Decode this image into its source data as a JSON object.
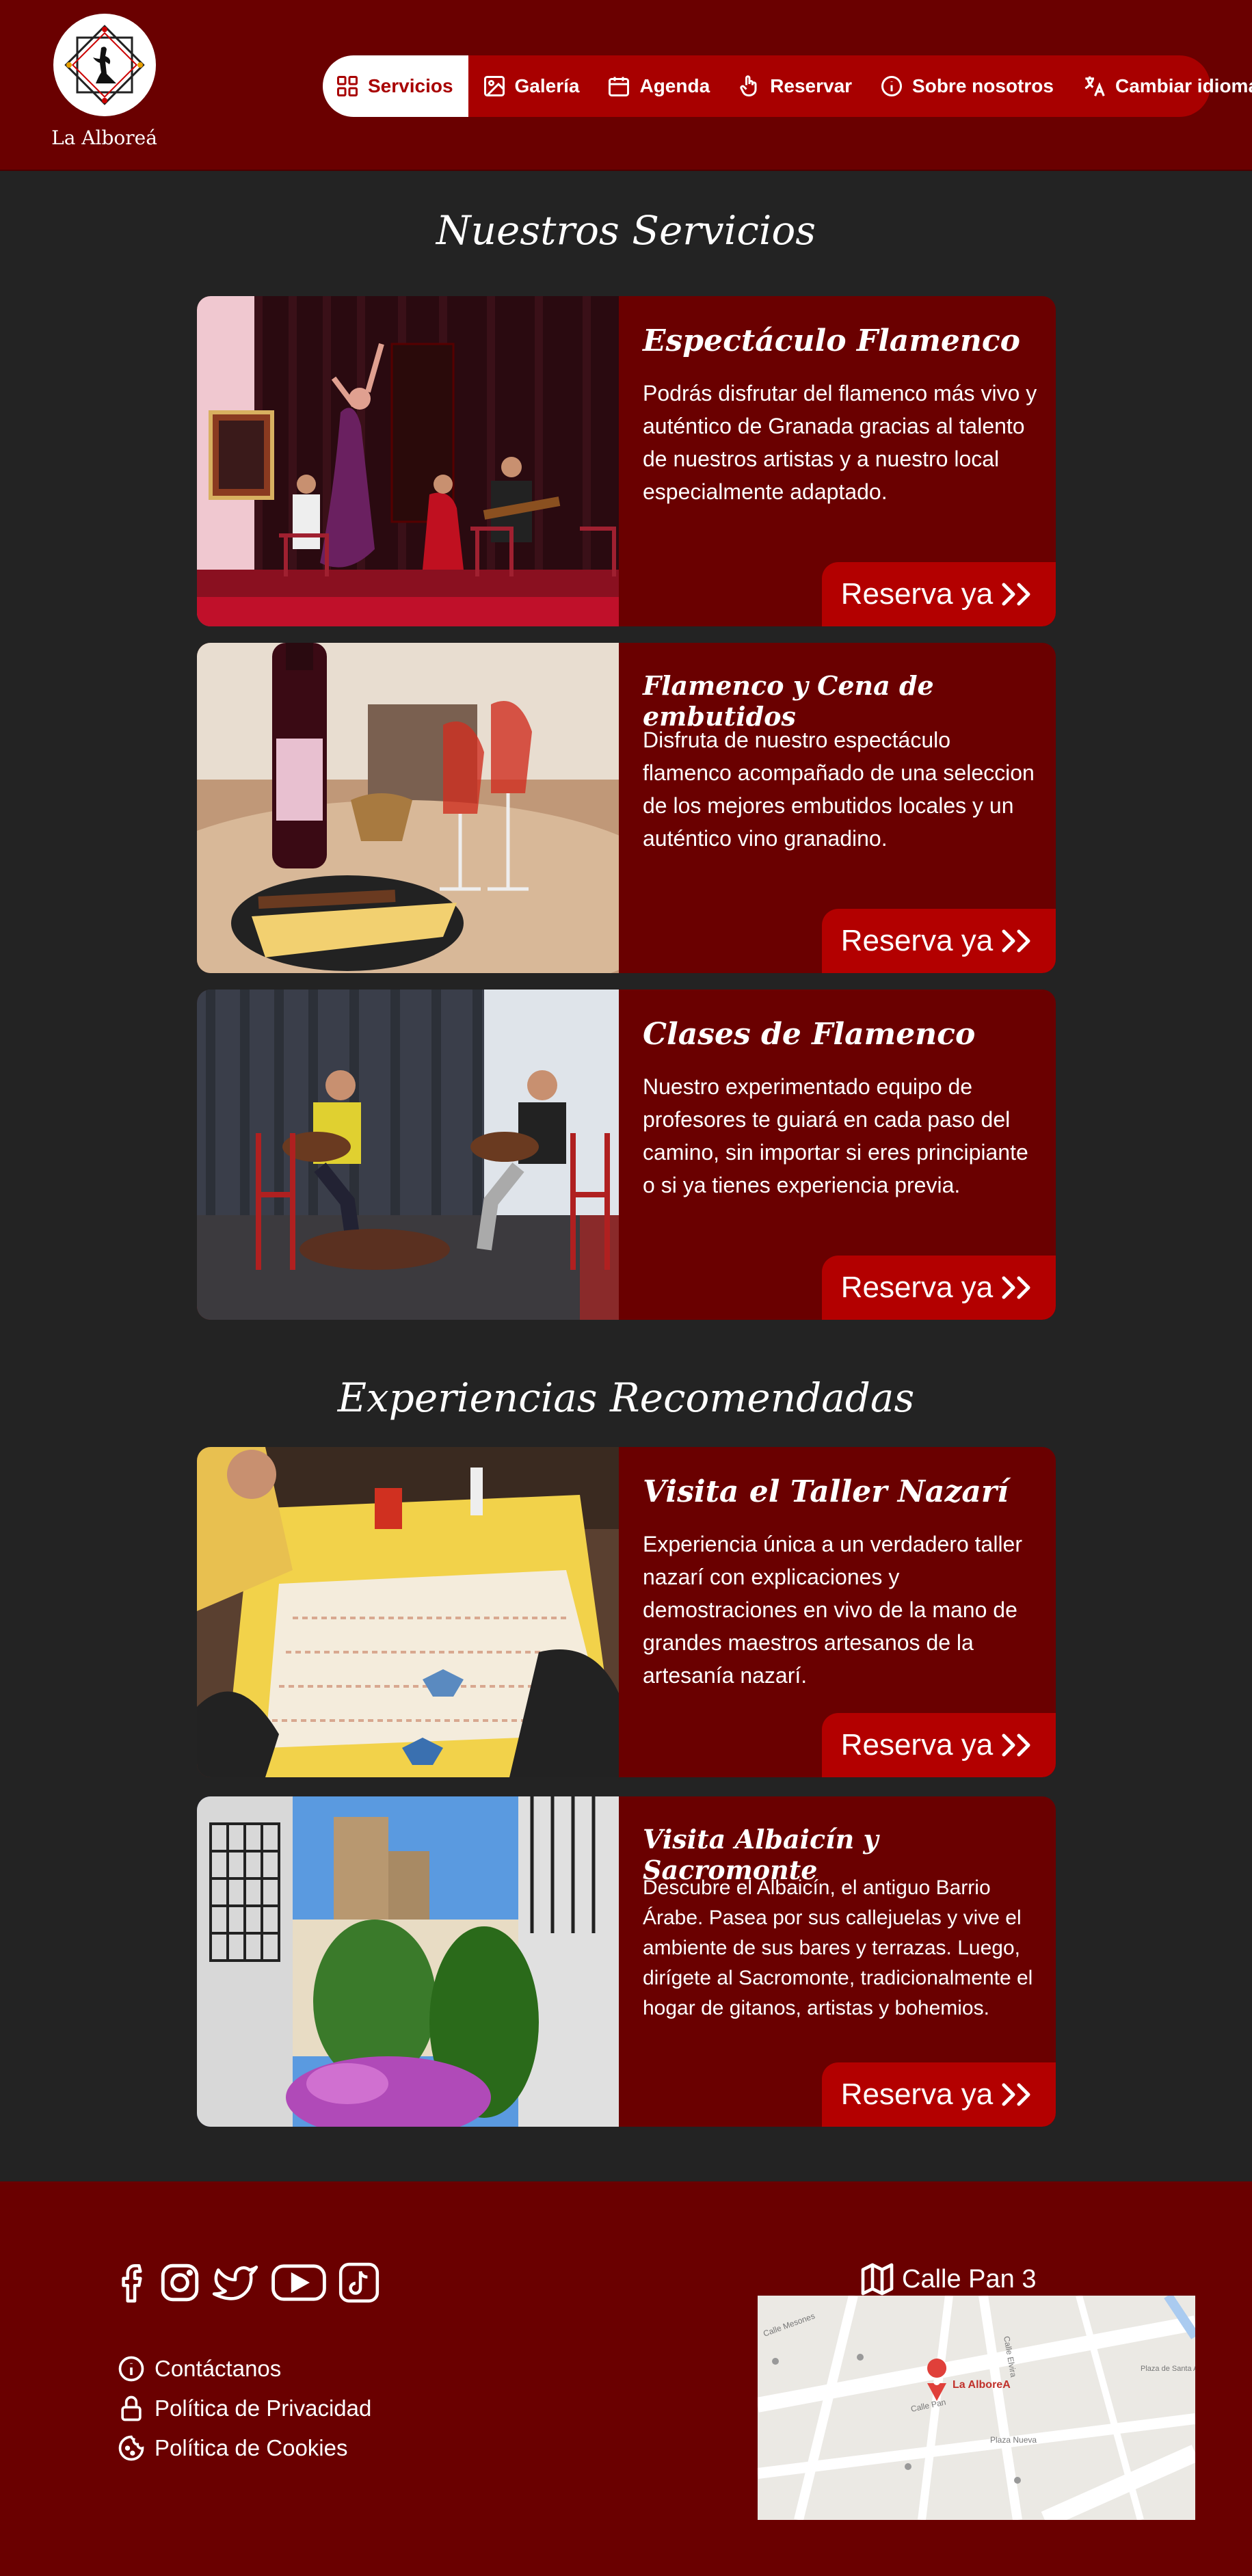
{
  "header": {
    "brand": "La Alboreá",
    "nav": [
      {
        "label": "Servicios",
        "icon": "grid-icon"
      },
      {
        "label": "Galería",
        "icon": "gallery-icon"
      },
      {
        "label": "Agenda",
        "icon": "calendar-icon"
      },
      {
        "label": "Reservar",
        "icon": "hand-pointer-icon"
      },
      {
        "label": "Sobre nosotros",
        "icon": "info-icon"
      },
      {
        "label": "Cambiar idioma",
        "icon": "translate-icon"
      }
    ]
  },
  "sections": {
    "services_title": "Nuestros Servicios",
    "experiences_title": "Experiencias Recomendadas"
  },
  "services": [
    {
      "title": "Espectáculo Flamenco",
      "text": "Podrás disfrutar del flamenco más vivo y auténtico de Granada gracias al talento de nuestros artistas y a nuestro local especialmente adaptado.",
      "button": "Reserva ya"
    },
    {
      "title": "Flamenco y Cena de embutidos",
      "text": "Disfruta de nuestro espectáculo flamenco acompañado de una seleccion de los mejores embutidos locales y un auténtico vino granadino.",
      "button": "Reserva ya"
    },
    {
      "title": "Clases de Flamenco",
      "text": "Nuestro experimentado equipo de profesores te guiará en cada paso del camino, sin importar si eres principiante o si ya tienes experiencia previa.",
      "button": "Reserva ya"
    }
  ],
  "experiences": [
    {
      "title": "Visita el Taller Nazarí",
      "text": "Experiencia única a un verdadero taller nazarí  con explicaciones y demostraciones en vivo de la mano de grandes maestros artesanos de la artesanía nazarí.",
      "button": "Reserva ya"
    },
    {
      "title": "Visita Albaicín y Sacromonte",
      "text": "Descubre el Albaicín, el antiguo Barrio Árabe. Pasea por sus callejuelas y vive el ambiente de sus bares y terrazas. Luego, dirígete al Sacromonte, tradicionalmente el hogar de gitanos, artistas y bohemios.",
      "button": "Reserva ya"
    }
  ],
  "footer": {
    "social": [
      "facebook-icon",
      "instagram-icon",
      "twitter-icon",
      "youtube-icon",
      "tiktok-icon"
    ],
    "links": [
      {
        "label": "Contáctanos",
        "icon": "info-icon"
      },
      {
        "label": "Política de Privacidad",
        "icon": "lock-icon"
      },
      {
        "label": "Política de Cookies",
        "icon": "cookie-icon"
      }
    ],
    "address": "Calle Pan 3",
    "map": {
      "pin_label": "La AlboreA",
      "streets": [
        "Plaza Nueva",
        "Calle Pan",
        "Calle Elvira",
        "Plaza de Santa Ana",
        "Calle Mesones"
      ]
    }
  },
  "colors": {
    "header_bg": "#6a0000",
    "nav_bg": "#a80000",
    "page_bg": "#232323",
    "card_bg": "#6a0000",
    "button_bg": "#b30000"
  }
}
